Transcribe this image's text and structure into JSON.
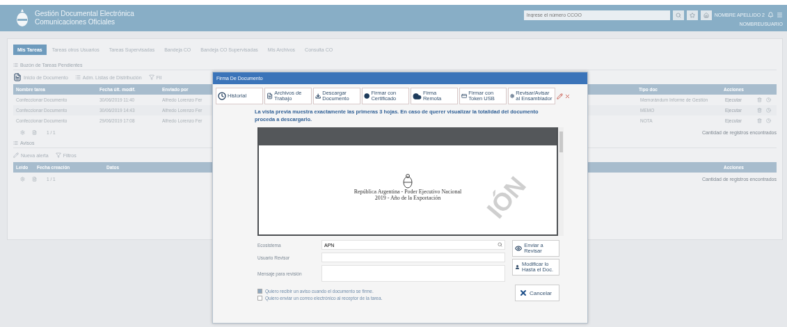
{
  "header": {
    "title": "Gestión Documental Electrónica",
    "subtitle": "Comunicaciones Oficiales",
    "search_placeholder": "Ingrese el número CCOO",
    "user": "NOMBRE APELLIDO 2",
    "user_detail": "NOMBREUSUARIO"
  },
  "tabs": [
    {
      "label": "Mis Tareas",
      "selected": true
    },
    {
      "label": "Tareas otros Usuarios",
      "selected": false
    },
    {
      "label": "Tareas Supervisadas",
      "selected": false
    },
    {
      "label": "Bandeja CO",
      "selected": false
    },
    {
      "label": "Bandeja CO Supervisadas",
      "selected": false
    },
    {
      "label": "Mis Archivos",
      "selected": false
    },
    {
      "label": "Consulta CO",
      "selected": false
    }
  ],
  "inbox": {
    "title": "Buzón de Tareas Pendientes",
    "toolbar": [
      {
        "label": "Inicio de Documento"
      },
      {
        "label": "Adm. Listas de Distribución"
      },
      {
        "label": "Fil"
      }
    ],
    "columns_left": [
      "Nombre tarea",
      "Fecha últ. modif.",
      "Enviado por"
    ],
    "columns_right": [
      "Tipo doc",
      "Acciones"
    ],
    "rows": [
      {
        "task": "Confeccionar Documento",
        "date": "30/06/2019 11:40",
        "sender": "Alfredo Lorenzo Fer",
        "doc_type": "Memorándum Informe de Gestión",
        "action": "Ejecutar"
      },
      {
        "task": "Confeccionar Documento",
        "date": "30/06/2019 14:43",
        "sender": "Alfredo Lorenzo Fer",
        "doc_type": "MEMO",
        "action": "Ejecutar"
      },
      {
        "task": "Confeccionar Documento",
        "date": "29/06/2019 17:08",
        "sender": "Alfredo Lorenzo Fer",
        "doc_type": "NOTA",
        "action": "Ejecutar"
      }
    ],
    "pager": "1 / 1",
    "count": "Cantidad de registros encontrados"
  },
  "alerts": {
    "title": "Avisos",
    "toolbar": [
      {
        "label": "Nueva alerta"
      },
      {
        "label": "Filtros"
      }
    ],
    "columns_left": [
      "Leído",
      "Fecha creación",
      "Datos"
    ],
    "columns_right": [
      "Acciones"
    ],
    "pager": "1 / 1",
    "count": "Cantidad de registros encontrados"
  },
  "dialog": {
    "title": "Firma De Documento",
    "tools": [
      {
        "label": "Historial"
      },
      {
        "label": "Archivos de Trabajo"
      },
      {
        "label": "Descargar Documento"
      },
      {
        "label": "Firmar con Certificado"
      },
      {
        "label": "Firma Remota"
      },
      {
        "label": "Firmar con Token USB"
      },
      {
        "label": "Revisar/Avisar al Ensamblador"
      }
    ],
    "notice": "La vista previa muestra exactamente las primeras 3 hojas. En caso de querer visualizar la totalidad del documento proceda a descargarlo.",
    "preview": {
      "lines": [
        "República Argentina - Poder Ejecutivo Nacional",
        "2019 - Año de la Exportación"
      ],
      "stamp": "IÓN"
    },
    "fields": [
      {
        "label": "Ecosistema",
        "kind": "search",
        "value": "APN"
      },
      {
        "label": "Usuario Revisor",
        "kind": "text"
      },
      {
        "label": "Mensaje para revisión",
        "kind": "textarea"
      }
    ],
    "side_buttons": [
      {
        "label": "Enviar a Revisar"
      },
      {
        "label": "Modificar lo Hasta el Doc."
      }
    ],
    "options": [
      {
        "label": "Quiero recibir un aviso cuando el documento se firme.",
        "checked": true
      },
      {
        "label": "Quiero enviar un correo electrónico al receptor de la tarea.",
        "checked": false
      }
    ],
    "cancel": "Cancelar"
  }
}
